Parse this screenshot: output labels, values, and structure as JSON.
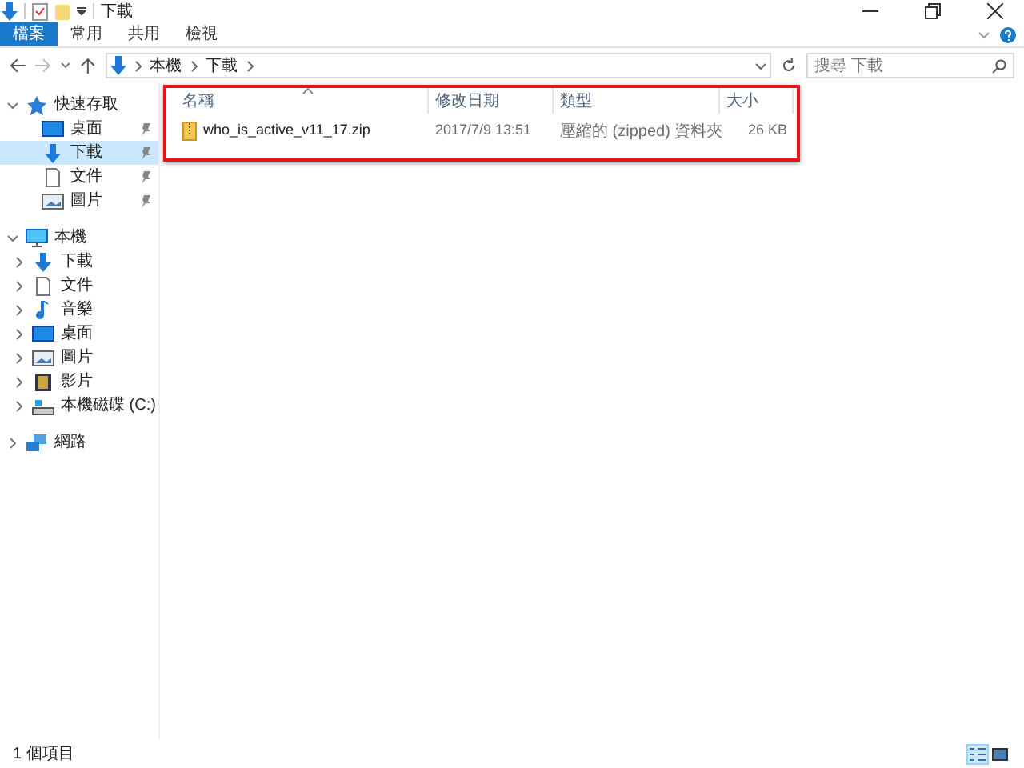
{
  "window": {
    "title": "下載"
  },
  "ribbon_tabs": [
    {
      "label": "檔案",
      "selected": true
    },
    {
      "label": "常用",
      "selected": false
    },
    {
      "label": "共用",
      "selected": false
    },
    {
      "label": "檢視",
      "selected": false
    }
  ],
  "address": {
    "path": [
      "本機",
      "下載"
    ],
    "search_placeholder": "搜尋 下載"
  },
  "navigation": [
    {
      "label": "快速存取",
      "kind": "star",
      "expanded": true,
      "children": [
        {
          "label": "桌面",
          "kind": "desktop",
          "pinned": true,
          "selected": false
        },
        {
          "label": "下載",
          "kind": "download",
          "pinned": true,
          "selected": true
        },
        {
          "label": "文件",
          "kind": "document",
          "pinned": true,
          "selected": false
        },
        {
          "label": "圖片",
          "kind": "picture",
          "pinned": true,
          "selected": false
        }
      ]
    },
    {
      "label": "本機",
      "kind": "pc",
      "expanded": true,
      "children": [
        {
          "label": "下載",
          "kind": "download",
          "expanded": false,
          "selected": false
        },
        {
          "label": "文件",
          "kind": "document",
          "expanded": false,
          "selected": false
        },
        {
          "label": "音樂",
          "kind": "music",
          "expanded": false,
          "selected": false
        },
        {
          "label": "桌面",
          "kind": "desktop",
          "expanded": false,
          "selected": false
        },
        {
          "label": "圖片",
          "kind": "picture",
          "expanded": false,
          "selected": false
        },
        {
          "label": "影片",
          "kind": "video",
          "expanded": false,
          "selected": false
        },
        {
          "label": "本機磁碟 (C:)",
          "kind": "drive",
          "expanded": false,
          "selected": false
        }
      ]
    },
    {
      "label": "網路",
      "kind": "network",
      "expanded": false
    }
  ],
  "columns": [
    {
      "label": "名稱",
      "sorted": true
    },
    {
      "label": "修改日期",
      "sorted": false
    },
    {
      "label": "類型",
      "sorted": false
    },
    {
      "label": "大小",
      "sorted": false
    }
  ],
  "rows": [
    {
      "name": "who_is_active_v11_17.zip",
      "modified": "2017/7/9 13:51",
      "type": "壓縮的 (zipped) 資料夾",
      "size": "26 KB"
    }
  ],
  "status_bar": {
    "count": "1 個項目",
    "views": [
      {
        "kind": "details",
        "selected": true
      },
      {
        "kind": "large",
        "selected": false
      }
    ]
  }
}
